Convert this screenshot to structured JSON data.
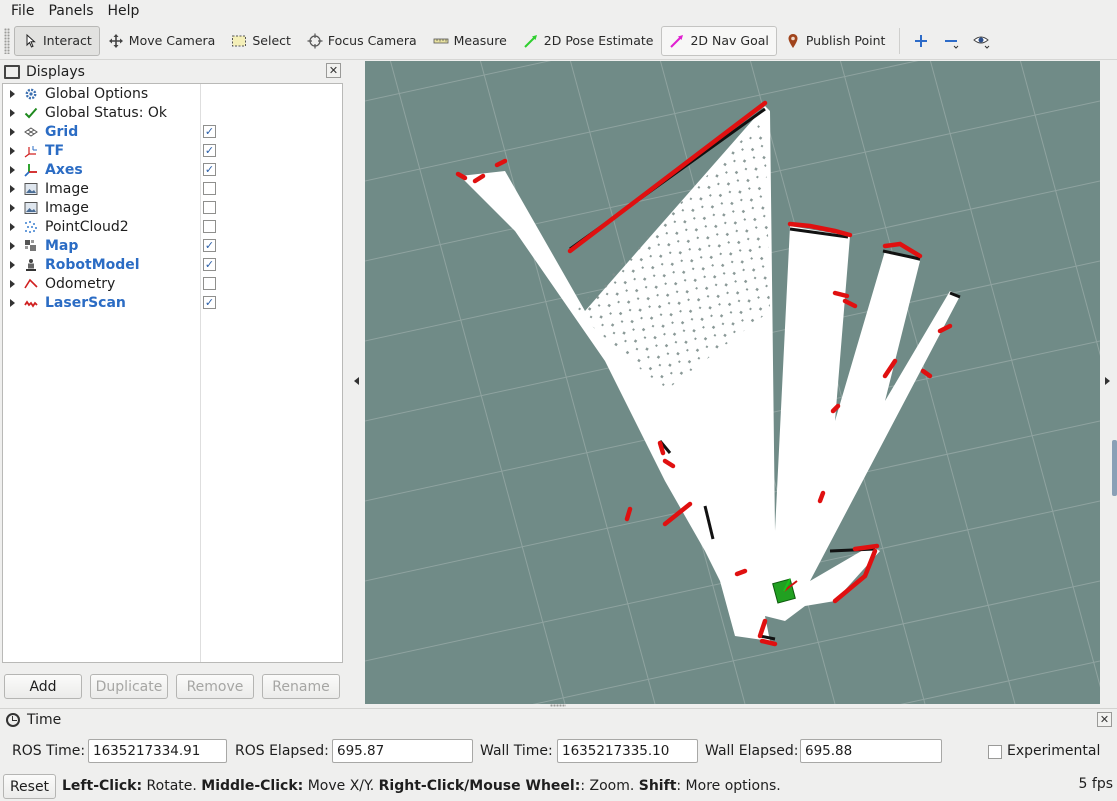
{
  "menu": [
    "File",
    "Panels",
    "Help"
  ],
  "toolbar": {
    "tools": [
      {
        "label": "Interact",
        "icon": "cursor-icon"
      },
      {
        "label": "Move Camera",
        "icon": "move-icon"
      },
      {
        "label": "Select",
        "icon": "select-box-icon"
      },
      {
        "label": "Focus Camera",
        "icon": "crosshair-icon"
      },
      {
        "label": "Measure",
        "icon": "ruler-icon"
      },
      {
        "label": "2D Pose Estimate",
        "icon": "green-arrow-icon"
      },
      {
        "label": "2D Nav Goal",
        "icon": "magenta-arrow-icon"
      },
      {
        "label": "Publish Point",
        "icon": "map-pin-icon"
      }
    ]
  },
  "displays": {
    "title": "Displays",
    "items": [
      {
        "label": "Global Options",
        "checkbox": null
      },
      {
        "label": "Global Status: Ok",
        "checkbox": null
      },
      {
        "label": "Grid",
        "checkbox": true
      },
      {
        "label": "TF",
        "checkbox": true
      },
      {
        "label": "Axes",
        "checkbox": true
      },
      {
        "label": "Image",
        "checkbox": false
      },
      {
        "label": "Image",
        "checkbox": false
      },
      {
        "label": "PointCloud2",
        "checkbox": false
      },
      {
        "label": "Map",
        "checkbox": true
      },
      {
        "label": "RobotModel",
        "checkbox": true
      },
      {
        "label": "Odometry",
        "checkbox": false
      },
      {
        "label": "LaserScan",
        "checkbox": true
      }
    ],
    "buttons": {
      "add": "Add",
      "duplicate": "Duplicate",
      "remove": "Remove",
      "rename": "Rename"
    }
  },
  "time": {
    "title": "Time",
    "ros_time_label": "ROS Time:",
    "ros_time": "1635217334.91",
    "ros_elapsed_label": "ROS Elapsed:",
    "ros_elapsed": "695.87",
    "wall_time_label": "Wall Time:",
    "wall_time": "1635217335.10",
    "wall_elapsed_label": "Wall Elapsed:",
    "wall_elapsed": "695.88",
    "experimental": "Experimental"
  },
  "status": {
    "reset": "Reset",
    "left_click": "Left-Click:",
    "left_click_action": " Rotate. ",
    "middle_click": "Middle-Click:",
    "middle_click_action": " Move X/Y. ",
    "right_click": "Right-Click/Mouse Wheel:",
    "right_click_action": ": Zoom. ",
    "shift": "Shift",
    "shift_action": ": More options.",
    "fps": "5 fps"
  }
}
